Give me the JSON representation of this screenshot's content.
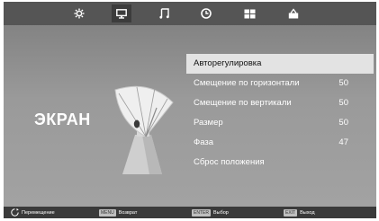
{
  "tabs": [
    {
      "icon": "picture-settings-icon",
      "active": false
    },
    {
      "icon": "screen-icon",
      "active": true
    },
    {
      "icon": "music-note-icon",
      "active": false
    },
    {
      "icon": "clock-icon",
      "active": false
    },
    {
      "icon": "grid-icon",
      "active": false
    },
    {
      "icon": "lock-icon",
      "active": false
    }
  ],
  "heading": "ЭКРАН",
  "menu": {
    "items": [
      {
        "label": "Авторегулировка",
        "value": ""
      },
      {
        "label": "Смещение по горизонтали",
        "value": "50"
      },
      {
        "label": "Смещение по вертикали",
        "value": "50"
      },
      {
        "label": "Размер",
        "value": "50"
      },
      {
        "label": "Фаза",
        "value": "47"
      },
      {
        "label": "Сброс положения",
        "value": ""
      }
    ],
    "selected_index": 0
  },
  "footer": {
    "move_label": "Перемещение",
    "menu_key": "MENU",
    "menu_label": "Возврат",
    "enter_key": "ENTER",
    "enter_label": "Выбор",
    "exit_key": "EXIT",
    "exit_label": "Выход"
  },
  "colors": {
    "background": "#9a9a9a",
    "topbar": "#555555",
    "selection": "#e3e3e3",
    "footer": "#3a3a3a"
  }
}
